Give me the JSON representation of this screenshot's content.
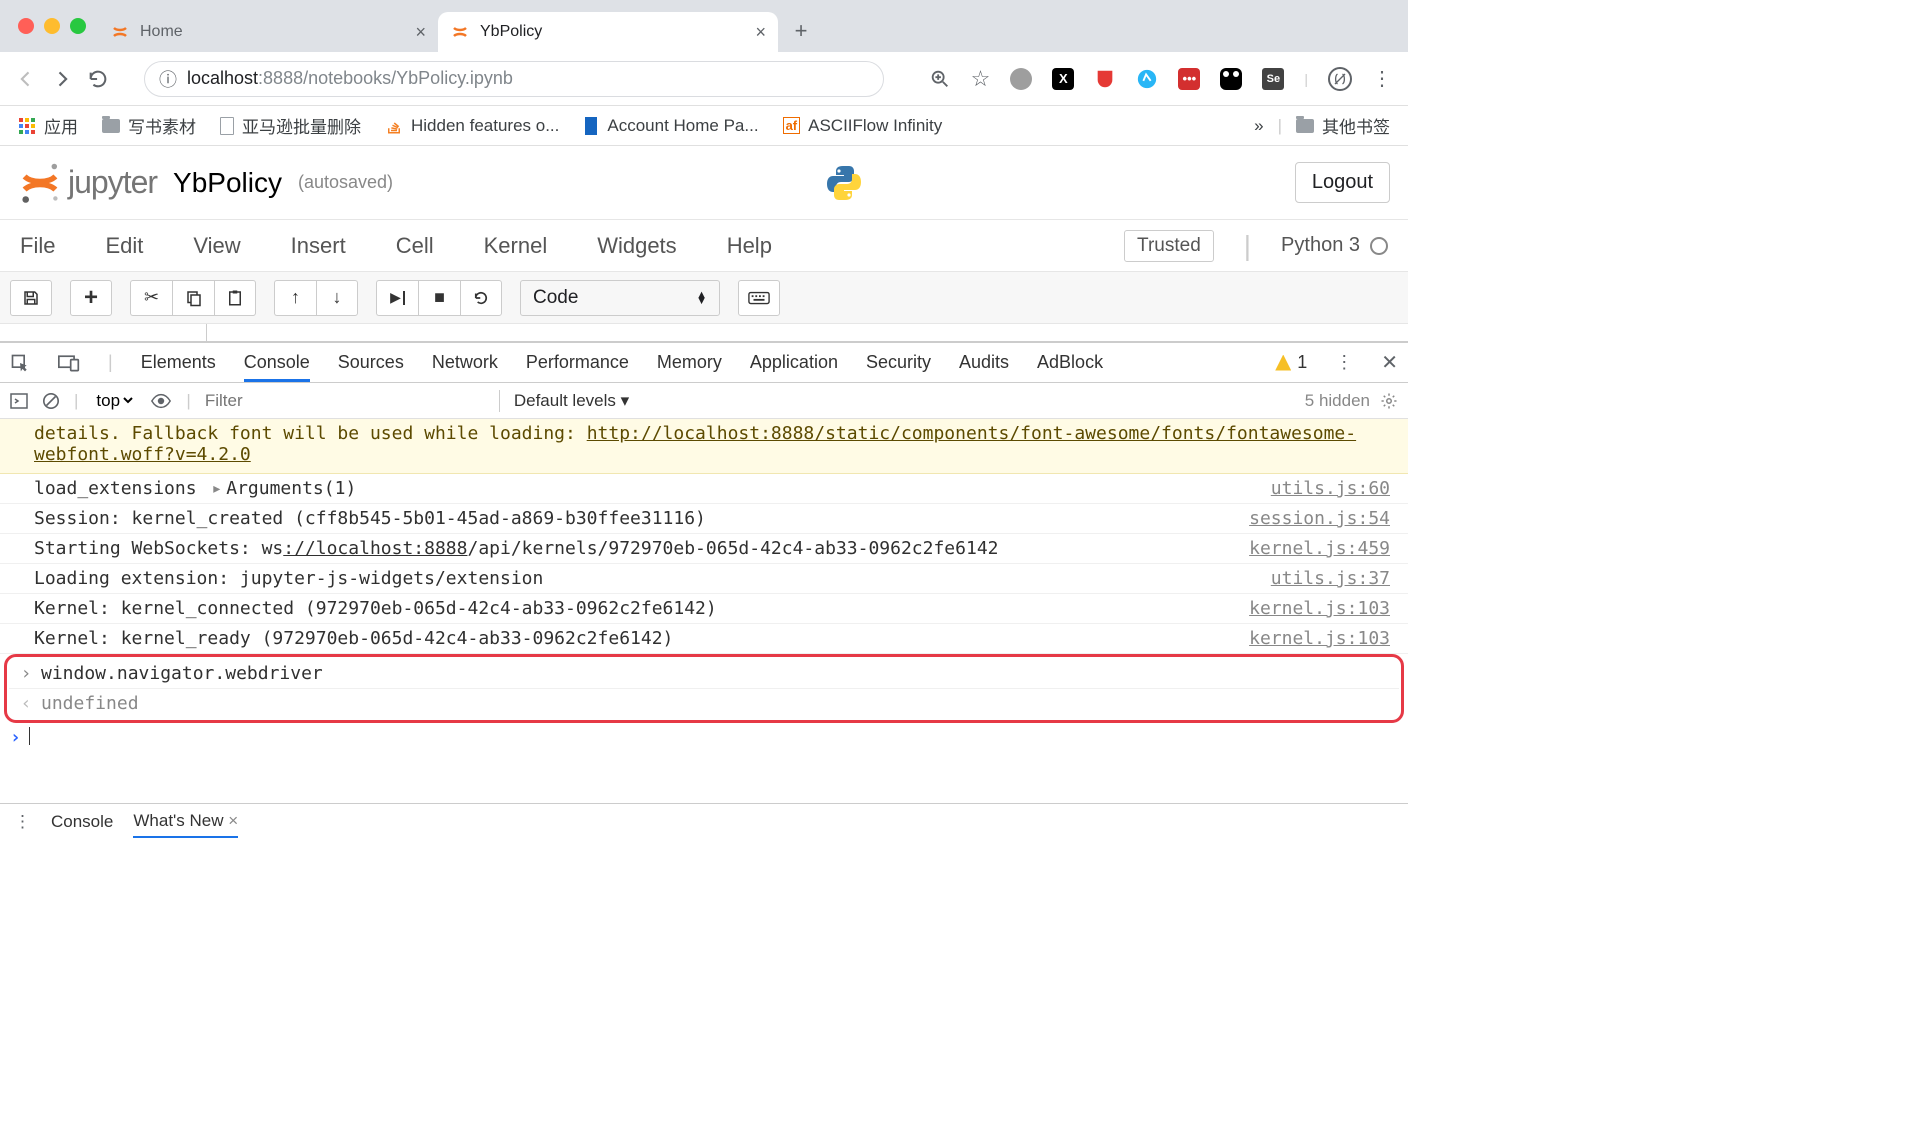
{
  "browser": {
    "tabs": [
      {
        "title": "Home"
      },
      {
        "title": "YbPolicy"
      }
    ],
    "url_host": "localhost",
    "url_port": ":8888",
    "url_path": "/notebooks/YbPolicy.ipynb"
  },
  "bookmarks": {
    "apps": "应用",
    "items": [
      "写书素材",
      "亚马逊批量删除",
      "Hidden features o...",
      "Account Home Pa...",
      "ASCIIFlow Infinity"
    ],
    "more": "»",
    "other": "其他书签"
  },
  "jupyter": {
    "brand": "jupyter",
    "notebook": "YbPolicy",
    "autosaved": "(autosaved)",
    "logout": "Logout",
    "menu": [
      "File",
      "Edit",
      "View",
      "Insert",
      "Cell",
      "Kernel",
      "Widgets",
      "Help"
    ],
    "trusted": "Trusted",
    "kernel": "Python 3",
    "celltype": "Code"
  },
  "devtools": {
    "tabs": [
      "Elements",
      "Console",
      "Sources",
      "Network",
      "Performance",
      "Memory",
      "Application",
      "Security",
      "Audits",
      "AdBlock"
    ],
    "warn_count": "1",
    "context": "top",
    "filter_placeholder": "Filter",
    "levels": "Default levels ▾",
    "hidden": "5 hidden",
    "warn_prefix": "details. Fallback font will be used while loading: ",
    "warn_link": "http://localhost:8888/static/components/font-awesome/fonts/fontawesome-webfont.woff?v=4.2.0",
    "logs": [
      {
        "text": "load_extensions ",
        "arg": "Arguments(1)",
        "src": "utils.js:60"
      },
      {
        "text": "Session: kernel_created (cff8b545-5b01-45ad-a869-b30ffee31116)",
        "src": "session.js:54"
      },
      {
        "text_pre": "Starting WebSockets: ws",
        "text_link": "://localhost:8888",
        "text_post": "/api/kernels/972970eb-065d-42c4-ab33-0962c2fe6142",
        "src": "kernel.js:459"
      },
      {
        "text": "Loading extension: jupyter-js-widgets/extension",
        "src": "utils.js:37"
      },
      {
        "text": "Kernel: kernel_connected (972970eb-065d-42c4-ab33-0962c2fe6142)",
        "src": "kernel.js:103"
      },
      {
        "text": "Kernel: kernel_ready (972970eb-065d-42c4-ab33-0962c2fe6142)",
        "src": "kernel.js:103"
      }
    ],
    "input": "window.navigator.webdriver",
    "output": "undefined",
    "drawer": {
      "console": "Console",
      "whatsnew": "What's New"
    }
  }
}
